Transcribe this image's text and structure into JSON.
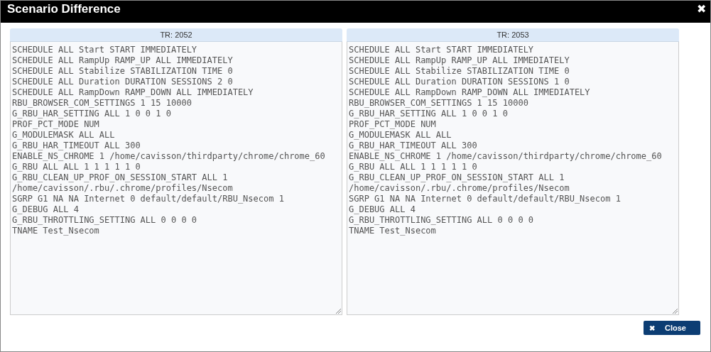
{
  "window": {
    "title": "Scenario Difference",
    "close_icon": "✖"
  },
  "panels": [
    {
      "header": "TR: 2052",
      "lines": [
        "SCHEDULE ALL Start START IMMEDIATELY",
        "SCHEDULE ALL RampUp RAMP_UP ALL IMMEDIATELY",
        "SCHEDULE ALL Stabilize STABILIZATION TIME 0",
        "SCHEDULE ALL Duration DURATION SESSIONS 2 0",
        "SCHEDULE ALL RampDown RAMP_DOWN ALL IMMEDIATELY",
        "RBU_BROWSER_COM_SETTINGS 1 15 10000",
        "G_RBU_HAR_SETTING ALL 1 0 0 1 0",
        "PROF_PCT_MODE NUM",
        "G_MODULEMASK ALL ALL",
        "G_RBU_HAR_TIMEOUT ALL 300",
        "ENABLE_NS_CHROME 1 /home/cavisson/thirdparty/chrome/chrome_60",
        "G_RBU ALL ALL 1 1 1 1 1 0",
        "G_RBU_CLEAN_UP_PROF_ON_SESSION_START ALL 1",
        "/home/cavisson/.rbu/.chrome/profiles/Nsecom",
        "SGRP G1 NA NA Internet 0 default/default/RBU_Nsecom 1",
        "G_DEBUG ALL 4",
        "G_RBU_THROTTLING_SETTING ALL 0 0 0 0",
        "TNAME Test_Nsecom"
      ]
    },
    {
      "header": "TR: 2053",
      "lines": [
        "SCHEDULE ALL Start START IMMEDIATELY",
        "SCHEDULE ALL RampUp RAMP_UP ALL IMMEDIATELY",
        "SCHEDULE ALL Stabilize STABILIZATION TIME 0",
        "SCHEDULE ALL Duration DURATION SESSIONS 1 0",
        "SCHEDULE ALL RampDown RAMP_DOWN ALL IMMEDIATELY",
        "RBU_BROWSER_COM_SETTINGS 1 15 10000",
        "G_RBU_HAR_SETTING ALL 1 0 0 1 0",
        "PROF_PCT_MODE NUM",
        "G_MODULEMASK ALL ALL",
        "G_RBU_HAR_TIMEOUT ALL 300",
        "ENABLE_NS_CHROME 1 /home/cavisson/thirdparty/chrome/chrome_60",
        "G_RBU ALL ALL 1 1 1 1 1 0",
        "G_RBU_CLEAN_UP_PROF_ON_SESSION_START ALL 1",
        "/home/cavisson/.rbu/.chrome/profiles/Nsecom",
        "SGRP G1 NA NA Internet 0 default/default/RBU_Nsecom 1",
        "G_DEBUG ALL 4",
        "G_RBU_THROTTLING_SETTING ALL 0 0 0 0",
        "TNAME Test_Nsecom"
      ]
    }
  ],
  "buttons": [
    {
      "label": "Close",
      "icon": "✖"
    }
  ]
}
